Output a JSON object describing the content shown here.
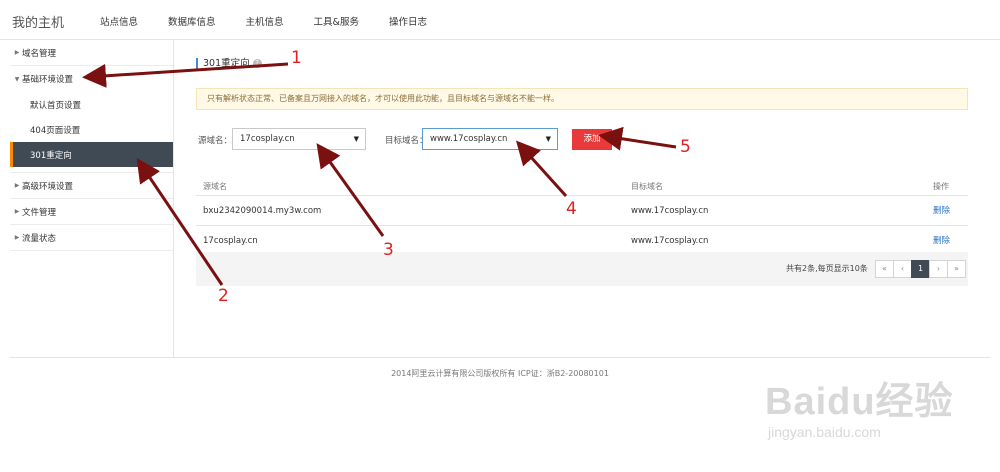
{
  "header": {
    "brand": "我的主机",
    "nav": [
      "站点信息",
      "数据库信息",
      "主机信息",
      "工具&服务",
      "操作日志"
    ]
  },
  "sidebar": {
    "groups": [
      {
        "label": "域名管理",
        "expanded": false
      },
      {
        "label": "基础环境设置",
        "expanded": true,
        "items": [
          "默认首页设置",
          "404页面设置",
          "301重定向"
        ]
      },
      {
        "label": "高级环境设置",
        "expanded": false
      },
      {
        "label": "文件管理",
        "expanded": false
      },
      {
        "label": "流量状态",
        "expanded": false
      }
    ],
    "active_item": "301重定向"
  },
  "main": {
    "title": "301重定向",
    "help_icon": "?",
    "notice": "只有解析状态正常、已备案且万网接入的域名，才可以使用此功能，且目标域名与源域名不能一样。",
    "form": {
      "source_label": "源域名：",
      "source_value": "17cosplay.cn",
      "target_label": "目标域名：",
      "target_value": "www.17cosplay.cn",
      "add_label": "添加"
    },
    "table": {
      "headers": [
        "源域名",
        "目标域名",
        "操作"
      ],
      "rows": [
        {
          "source": "bxu2342090014.my3w.com",
          "target": "www.17cosplay.cn",
          "action": "删除"
        },
        {
          "source": "17cosplay.cn",
          "target": "www.17cosplay.cn",
          "action": "删除"
        }
      ]
    },
    "pagination": {
      "info": "共有2条,每页显示10条",
      "buttons": [
        "«",
        "‹",
        "1",
        "›",
        "»"
      ],
      "current": "1"
    }
  },
  "footer": {
    "copyright": "2014阿里云计算有限公司版权所有 ICP证：浙B2-20080101"
  },
  "annotations": {
    "numbers": [
      "1",
      "2",
      "3",
      "4",
      "5"
    ],
    "color": "#e02020",
    "arrow_color": "#7a1010"
  },
  "watermark": {
    "logo": "Baidu经验",
    "url": "jingyan.baidu.com"
  },
  "colors": {
    "accent_active": "#3f4a55",
    "active_marker": "#ff8a00",
    "add_button": "#e83a3a",
    "link": "#2a73c9"
  }
}
